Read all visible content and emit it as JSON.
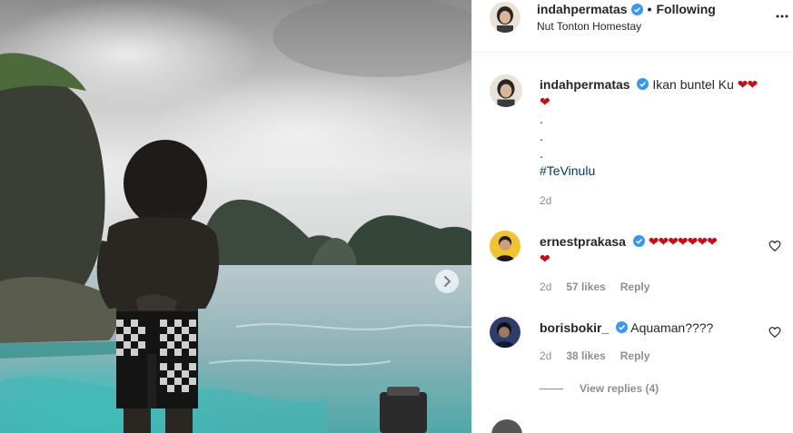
{
  "post": {
    "username": "indahpermatas",
    "follow_status": "Following",
    "separator": "•",
    "location": "Nut Tonton Homestay"
  },
  "caption": {
    "username": "indahpermatas",
    "text": "Ikan buntel Ku",
    "hearts_line1": "❤❤",
    "hearts_line2": "❤",
    "dot1": ".",
    "dot2": ".",
    "dot3": ".",
    "hashtag": "#TeVinulu",
    "time": "2d"
  },
  "comments": [
    {
      "username": "ernestprakasa",
      "hearts_line1": "❤❤❤❤❤❤❤",
      "hearts_line2": "❤",
      "time": "2d",
      "likes": "57 likes",
      "reply": "Reply"
    },
    {
      "username": "borisbokir_",
      "text": "Aquaman????",
      "time": "2d",
      "likes": "38 likes",
      "reply": "Reply"
    }
  ],
  "view_replies": "View replies (4)",
  "icons": {
    "verified": "verified-badge-icon",
    "more": "more-options-icon",
    "like": "heart-outline-icon",
    "next": "chevron-right-icon"
  },
  "colors": {
    "verified": "#3897f0",
    "heart": "#c2101a",
    "hashtag": "#00376b",
    "muted": "#8e8e8e"
  }
}
